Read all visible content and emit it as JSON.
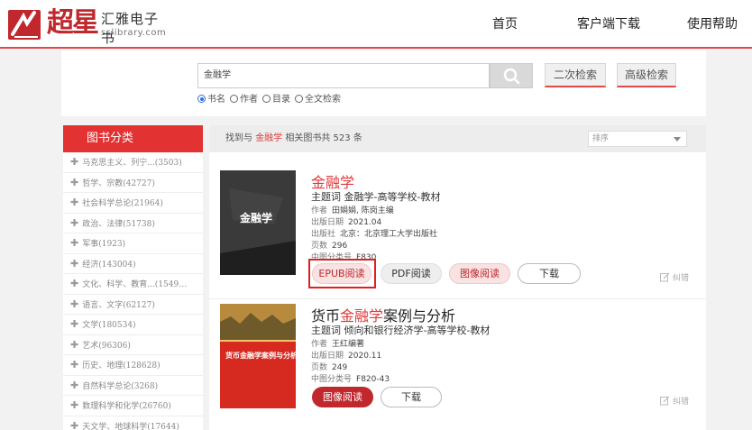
{
  "header": {
    "logo_big": "超星",
    "logo_cn": "汇雅电子书",
    "logo_en": "sslibrary.com",
    "nav": [
      "首页",
      "客户端下载",
      "使用帮助"
    ]
  },
  "search": {
    "query": "金融学",
    "secondary_search": "二次检索",
    "advanced_search": "高级检索",
    "options": [
      "书名",
      "作者",
      "目录",
      "全文检索"
    ],
    "selected": "书名"
  },
  "sidebar": {
    "title": "图书分类",
    "categories": [
      "马克思主义、列宁...(3503)",
      "哲学、宗教(42727)",
      "社会科学总论(21964)",
      "政治、法律(51738)",
      "军事(1923)",
      "经济(143004)",
      "文化、科学、教育...(1549…",
      "语言、文字(62127)",
      "文学(180534)",
      "艺术(96306)",
      "历史、地理(128628)",
      "自然科学总论(3268)",
      "数理科学和化学(26760)",
      "天文学、地球科学(17644)"
    ]
  },
  "results": {
    "prefix": "找到与",
    "keyword": "金融学",
    "suffix": "相关图书共 523 条",
    "sort_label": "排序"
  },
  "books": [
    {
      "title_hl": "金融学",
      "title_rest": "",
      "subject_label": "主题词",
      "subject": "金融学-高等学校-教材",
      "author_label": "作者",
      "author": "田娟娟, 陈岗主编",
      "date_label": "出版日期",
      "date": "2021.04",
      "publisher_label": "出版社",
      "publisher": "北京：北京理工大学出版社",
      "pages_label": "页数",
      "pages": "296",
      "class_label": "中图分类号",
      "class": "F830",
      "cover_text": "金融学",
      "buttons": [
        "EPUB阅读",
        "PDF阅读",
        "图像阅读",
        "下载"
      ],
      "report": "纠错"
    },
    {
      "title_pre": "货币",
      "title_hl": "金融学",
      "title_rest": "案例与分析",
      "subject_label": "主题词",
      "subject": "倾向和银行经济学-高等学校-教材",
      "author_label": "作者",
      "author": "王红编著",
      "date_label": "出版日期",
      "date": "2020.11",
      "pages_label": "页数",
      "pages": "249",
      "class_label": "中图分类号",
      "class": "F820-43",
      "cover_text": "货币金融学案例与分析",
      "buttons": [
        "图像阅读",
        "下载"
      ],
      "report": "纠错"
    }
  ],
  "colors": {
    "brand_red": "#c0282d",
    "accent_red": "#e23232",
    "highlight_red": "#e03a3a"
  }
}
